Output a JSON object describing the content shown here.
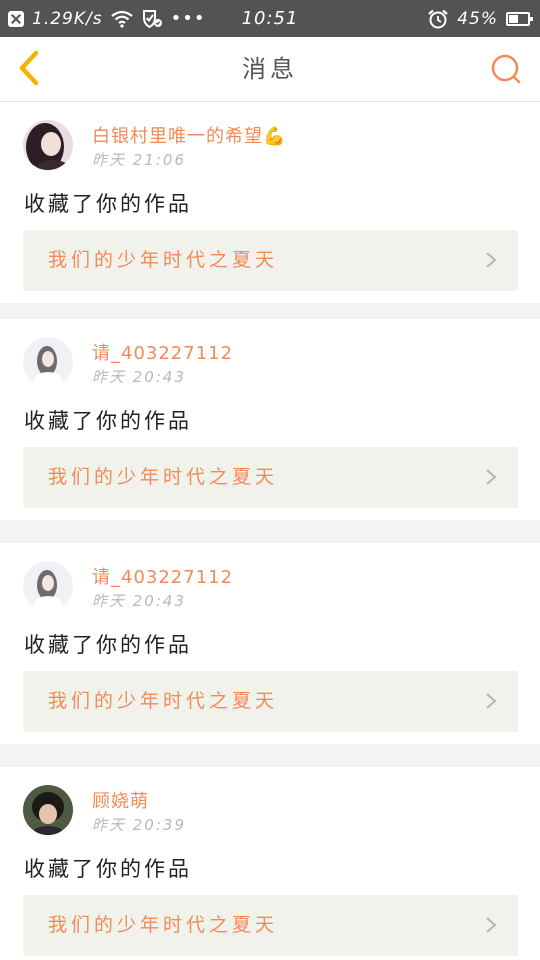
{
  "status_bar": {
    "net_speed": "1.29K/s",
    "dots": "•••",
    "time": "10:51",
    "battery": "45%",
    "battery_level": 0.45
  },
  "header": {
    "title": "消息"
  },
  "notifications": [
    {
      "username": "白银村里唯一的希望",
      "emoji": "💪",
      "time": "昨天 21:06",
      "action": "收藏了你的作品",
      "work_title": "我们的少年时代之夏天",
      "avatar_colors": [
        "#2b1e24",
        "#d9c2c8"
      ]
    },
    {
      "username": "请_403227112",
      "emoji": "",
      "time": "昨天 20:43",
      "action": "收藏了你的作品",
      "work_title": "我们的少年时代之夏天",
      "avatar_colors": [
        "#e8eef3",
        "#8c8f97"
      ]
    },
    {
      "username": "请_403227112",
      "emoji": "",
      "time": "昨天 20:43",
      "action": "收藏了你的作品",
      "work_title": "我们的少年时代之夏天",
      "avatar_colors": [
        "#e8eef3",
        "#8c8f97"
      ]
    },
    {
      "username": "顾娆萌",
      "emoji": "",
      "time": "昨天 20:39",
      "action": "收藏了你的作品",
      "work_title": "我们的少年时代之夏天",
      "avatar_colors": [
        "#1d1a14",
        "#5b6b4a"
      ]
    }
  ],
  "icons": {
    "back": "chevron-left-icon",
    "search": "search-icon",
    "arrow": "chevron-right-icon"
  },
  "colors": {
    "accent": "#f28b57",
    "back": "#f3b400"
  }
}
